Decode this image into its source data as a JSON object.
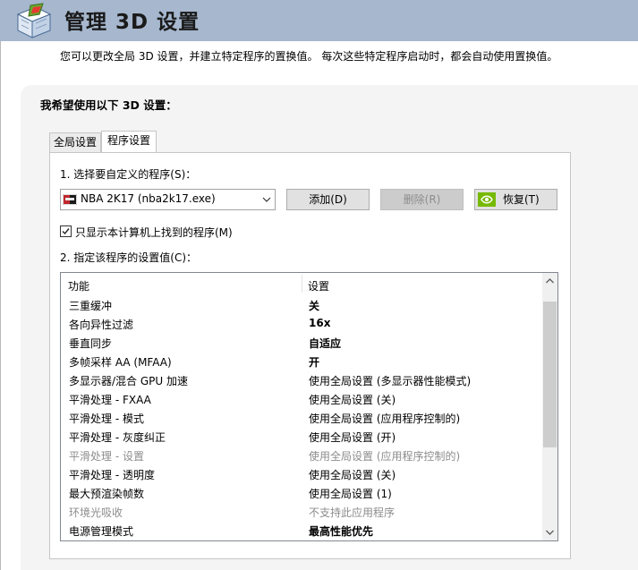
{
  "header": {
    "title": "管理 3D 设置",
    "icon": "nvidia-3d-cube-icon",
    "background": "#a6b7ce"
  },
  "description": "您可以更改全局 3D 设置，并建立特定程序的置换值。 每次这些特定程序启动时，都会自动使用置换值。",
  "panel": {
    "title": "我希望使用以下 3D 设置：",
    "tabs": [
      {
        "label": "全局设置",
        "active": false
      },
      {
        "label": "程序设置",
        "active": true
      }
    ]
  },
  "program": {
    "step1_label": "1. 选择要自定义的程序(S)：",
    "selected": "NBA 2K17 (nba2k17.exe)",
    "add_label": "添加(D)",
    "remove_label": "删除(R)",
    "restore_label": "恢复(T)",
    "checkbox_label": "只显示本计算机上找到的程序(M)",
    "checkbox_checked": true,
    "step2_label": "2. 指定该程序的设置值(C)："
  },
  "settings_table": {
    "col_feature": "功能",
    "col_setting": "设置",
    "rows": [
      {
        "feature": "三重缓冲",
        "setting": "关",
        "bold": true,
        "gray": false
      },
      {
        "feature": "各向异性过滤",
        "setting": "16x",
        "bold": true,
        "gray": false
      },
      {
        "feature": "垂直同步",
        "setting": "自适应",
        "bold": true,
        "gray": false
      },
      {
        "feature": "多帧采样 AA (MFAA)",
        "setting": "开",
        "bold": true,
        "gray": false
      },
      {
        "feature": "多显示器/混合 GPU 加速",
        "setting": "使用全局设置 (多显示器性能模式)",
        "bold": false,
        "gray": false
      },
      {
        "feature": "平滑处理 - FXAA",
        "setting": "使用全局设置 (关)",
        "bold": false,
        "gray": false
      },
      {
        "feature": "平滑处理 - 模式",
        "setting": "使用全局设置 (应用程序控制的)",
        "bold": false,
        "gray": false
      },
      {
        "feature": "平滑处理 - 灰度纠正",
        "setting": "使用全局设置 (开)",
        "bold": false,
        "gray": false
      },
      {
        "feature": "平滑处理 - 设置",
        "setting": "使用全局设置 (应用程序控制的)",
        "bold": false,
        "gray": true
      },
      {
        "feature": "平滑处理 - 透明度",
        "setting": "使用全局设置 (关)",
        "bold": false,
        "gray": false
      },
      {
        "feature": "最大预渲染帧数",
        "setting": "使用全局设置 (1)",
        "bold": false,
        "gray": false
      },
      {
        "feature": "环境光吸收",
        "setting": "不支持此应用程序",
        "bold": false,
        "gray": true
      },
      {
        "feature": "电源管理模式",
        "setting": "最高性能优先",
        "bold": true,
        "gray": false
      }
    ]
  },
  "colors": {
    "accent_nvidia": "#76b900",
    "disabled_text": "#8d8d8d",
    "gray_text": "#8c8c8c"
  }
}
